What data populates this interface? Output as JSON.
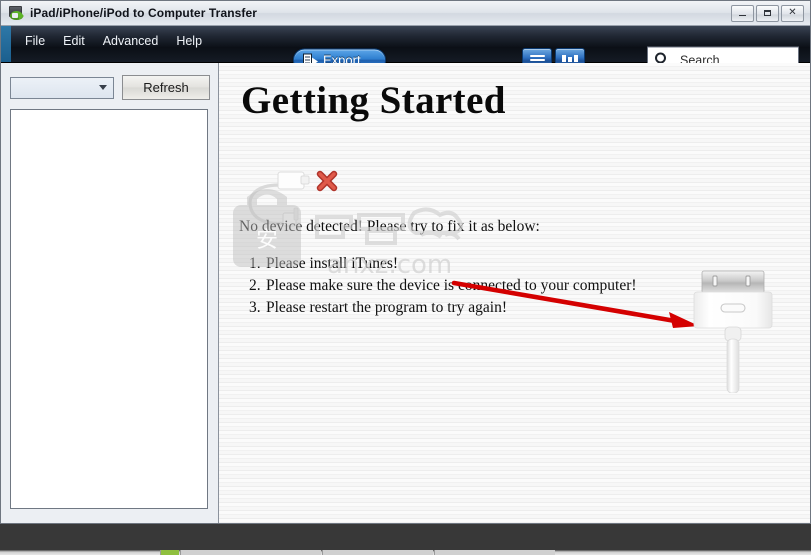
{
  "window": {
    "title": "iPad/iPhone/iPod to Computer Transfer",
    "app_icon": "transfer-device-icon",
    "controls": {
      "minimize": "minimize-icon",
      "maximize": "maximize-icon",
      "close": "✕"
    }
  },
  "toolbar": {
    "menu": [
      {
        "label": "File"
      },
      {
        "label": "Edit"
      },
      {
        "label": "Advanced"
      },
      {
        "label": "Help"
      }
    ],
    "export": {
      "label": "Export",
      "icon": "export-icon"
    },
    "view_toggles": [
      {
        "name": "list-view",
        "icon": "list-view-icon"
      },
      {
        "name": "column-view",
        "icon": "column-view-icon"
      }
    ],
    "search": {
      "placeholder": "Search",
      "value": "",
      "icon": "search-icon",
      "clear_icon": "clear-icon"
    }
  },
  "sidebar": {
    "device_select": {
      "value": "",
      "options": [],
      "chevron": "chevron-down-icon"
    },
    "refresh_label": "Refresh",
    "list_items": []
  },
  "main": {
    "heading": "Getting Started",
    "cable_icon": "disconnected-cable-icon",
    "error_badge": "red-x-icon",
    "message": "No device detected! Please try to fix it as below:",
    "steps": [
      {
        "number": "1.",
        "text": "Please install iTunes!"
      },
      {
        "number": "2.",
        "text": "Please make sure the device is connected to your computer!"
      },
      {
        "number": "3.",
        "text": "Please restart the program to try again!"
      }
    ],
    "dock_connector_icon": "dock-connector-icon",
    "pointer_arrow_icon": "red-arrow-icon"
  },
  "watermark": {
    "text": "anxz.com",
    "cn_text": "安下载"
  },
  "colors": {
    "accent_blue": "#2f7fd0",
    "toolbar_dark": "#0b0f16",
    "error_red": "#c0392b",
    "arrow_red": "#d40000",
    "title_text": "#10131a"
  }
}
